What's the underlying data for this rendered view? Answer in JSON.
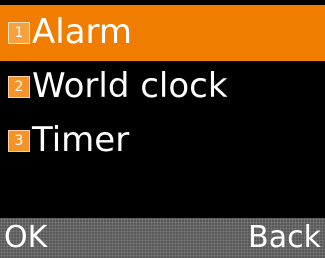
{
  "menu": {
    "items": [
      {
        "number": "1",
        "label": "Alarm",
        "selected": true
      },
      {
        "number": "2",
        "label": "World clock",
        "selected": false
      },
      {
        "number": "3",
        "label": "Timer",
        "selected": false
      }
    ]
  },
  "softkeys": {
    "left_label": "OK",
    "right_label": "Back"
  },
  "colors": {
    "selection": "#f07d00",
    "badge": "#f5932a",
    "background": "#000000",
    "softkey_bar": "#5a5a5a"
  }
}
